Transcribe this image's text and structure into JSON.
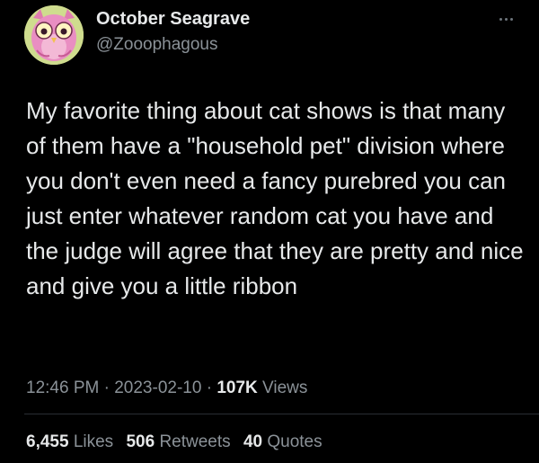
{
  "author": {
    "display_name": "October Seagrave",
    "handle": "@Zooophagous",
    "avatar_icon": "pink-owl-avatar-icon"
  },
  "more_icon": "more-options-icon",
  "tweet": {
    "text": "My favorite thing about cat shows is that many of them have a \"household pet\" division where you don't even need a fancy purebred you can just enter whatever random cat you have and the judge will agree that they are pretty and nice and give you a little ribbon"
  },
  "meta": {
    "time": "12:46 PM",
    "separator1": "·",
    "date": "2023-02-10",
    "separator2": "·",
    "views_count": "107K",
    "views_label": "Views"
  },
  "stats": {
    "likes_count": "6,455",
    "likes_label": "Likes",
    "retweets_count": "506",
    "retweets_label": "Retweets",
    "quotes_count": "40",
    "quotes_label": "Quotes"
  },
  "colors": {
    "background": "#000000",
    "primary_text": "#e7e9ea",
    "secondary_text": "#8b9298",
    "divider": "#2a2e33"
  }
}
